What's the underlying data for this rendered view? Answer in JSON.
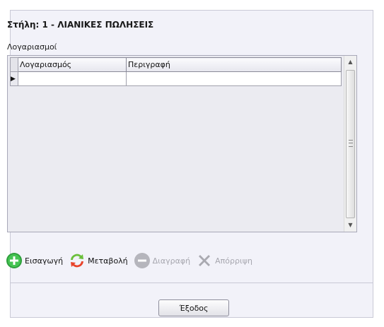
{
  "title_prefix": "Στήλη:",
  "title": "Στήλη: 1 - ΛΙΑΝΙΚΕΣ ΠΩΛΗΣΕΙΣ",
  "section_label": "Λογαριασμοί",
  "grid": {
    "columns": [
      "Λογαριασμός",
      "Περιγραφή"
    ],
    "rows": [
      [
        "",
        ""
      ]
    ],
    "current_row_indicator": "▶"
  },
  "toolbar": {
    "insert_label": "Εισαγωγή",
    "edit_label": "Μεταβολή",
    "delete_label": "Διαγραφή",
    "reject_label": "Απόρριψη"
  },
  "icons": {
    "insert": "plus-circle-green-icon",
    "edit": "refresh-arrows-icon",
    "delete": "minus-circle-icon",
    "reject": "x-mark-icon"
  },
  "exit_label": "Έξοδος",
  "colors": {
    "insert_icon": "#3bb54a",
    "edit_icon_red": "#e8432b",
    "edit_icon_green": "#6abf3a",
    "disabled": "#a6a6ae"
  }
}
